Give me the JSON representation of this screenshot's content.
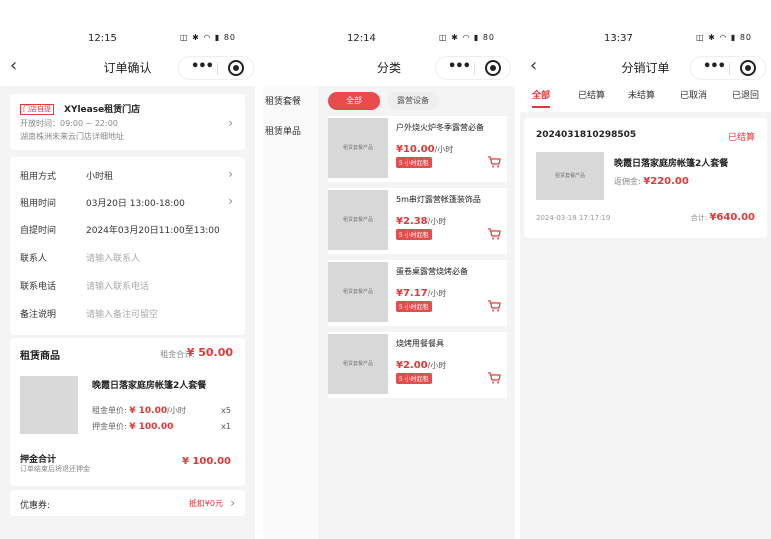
{
  "screen1": {
    "status_time": "12:15",
    "status_icons": "◫ ✱ ◠ ▮ 80",
    "title": "订单确认",
    "store": {
      "tag": "门店自提",
      "name": "XYlease租赁门店",
      "hours": "开放时间：09:00 ~ 22:00",
      "address": "湖南株洲未来云门店详细地址"
    },
    "form": [
      {
        "label": "租用方式",
        "value": "小时租",
        "placeholder": ""
      },
      {
        "label": "租用时间",
        "value": "03月20日 13:00-18:00",
        "placeholder": ""
      },
      {
        "label": "自提时间",
        "value": "2024年03月20日11:00至13:00",
        "placeholder": ""
      },
      {
        "label": "联系人",
        "value": "",
        "placeholder": "请输入联系人"
      },
      {
        "label": "联系电话",
        "value": "",
        "placeholder": "请输入联系电话"
      },
      {
        "label": "备注说明",
        "value": "",
        "placeholder": "请输入备注可留空"
      }
    ],
    "goods": {
      "title": "租赁商品",
      "total_label": "租金合计:",
      "total_value": "¥ 50.00",
      "item_name": "晚霞日落家庭房帐篷2人套餐",
      "rent_label": "租金单价: ",
      "rent_value": "¥ 10.00",
      "rent_unit": "/小时",
      "rent_qty": "x5",
      "deposit_label": "押金单价: ",
      "deposit_value": "¥ 100.00",
      "deposit_qty": "x1",
      "deposit_total_title": "押金合计",
      "deposit_total_note": "订单结束后将退还押金",
      "deposit_total_value": "¥ 100.00"
    },
    "coupon": {
      "label": "优惠券:",
      "value": "抵扣¥0元"
    }
  },
  "screen2": {
    "status_time": "12:14",
    "status_icons": "◫ ✱ ◠ ▮ 80",
    "title": "分类",
    "sidebar": [
      "租赁套餐",
      "租赁单品"
    ],
    "chips": [
      "全部",
      "露营设备"
    ],
    "products": [
      {
        "name": "户外烧火炉冬季露营必备",
        "price": "¥10.00",
        "unit": "/小时",
        "tag": "5 小时起租",
        "img": "租赁套餐产品"
      },
      {
        "name": "5m串灯露营帐篷装饰品",
        "price": "¥2.38",
        "unit": "/小时",
        "tag": "5 小时起租",
        "img": "租赁套餐产品"
      },
      {
        "name": "蛋卷桌露营烧烤必备",
        "price": "¥7.17",
        "unit": "/小时",
        "tag": "5 小时起租",
        "img": "租赁套餐产品"
      },
      {
        "name": "烧烤用餐餐具",
        "price": "¥2.00",
        "unit": "/小时",
        "tag": "5 小时起租",
        "img": "租赁套餐产品"
      }
    ]
  },
  "screen3": {
    "status_time": "13:37",
    "status_icons": "◫ ✱ ◠ ▮ 80",
    "title": "分销订单",
    "tabs": [
      "全部",
      "已结算",
      "未结算",
      "已取消",
      "已退回"
    ],
    "order": {
      "number": "2024031810298505",
      "status": "已结算",
      "img": "租赁套餐产品",
      "name": "晚霞日落家庭房帐篷2人套餐",
      "commission_label": "返佣金: ",
      "commission_value": "¥220.00",
      "time": "2024-03-18 17:17:19",
      "total_label": "合计: ",
      "total_value": "¥640.00"
    }
  },
  "colors": {
    "accent": "#e03a3a",
    "chip": "#e84b4b",
    "placeholder_img": "#d9d9d9"
  }
}
